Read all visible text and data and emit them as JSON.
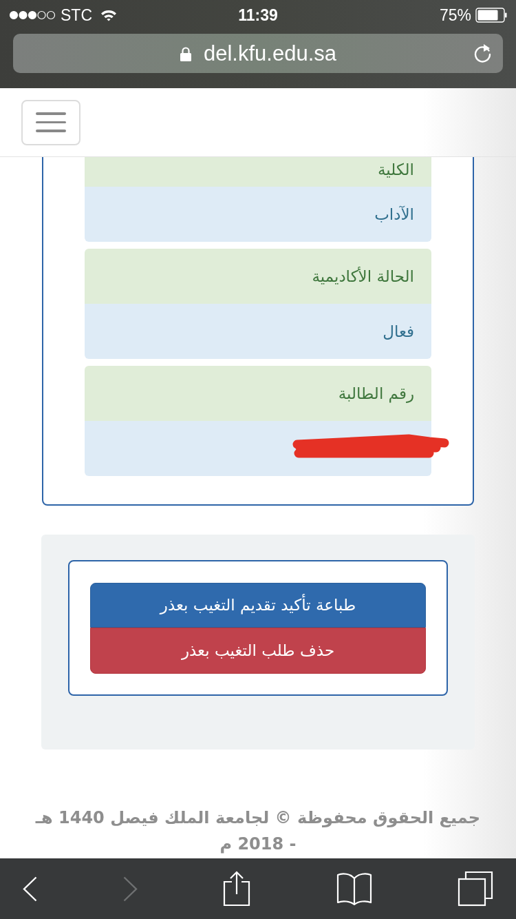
{
  "status_bar": {
    "carrier": "STC",
    "time": "11:39",
    "battery": "75%"
  },
  "address_bar": {
    "url": "del.kfu.edu.sa"
  },
  "info_card": {
    "fields": [
      {
        "label": "الكلية",
        "value": "الآداب",
        "redacted": false
      },
      {
        "label": "الحالة الأكاديمية",
        "value": "فعال",
        "redacted": false
      },
      {
        "label": "رقم الطالبة",
        "redacted": true
      }
    ]
  },
  "actions": {
    "buttons": [
      {
        "label": "طباعة تأكيد تقديم التغيب بعذر",
        "kind": "primary"
      },
      {
        "label": "حذف طلب التغيب بعذر",
        "kind": "danger"
      }
    ]
  },
  "footer": {
    "text": "جميع الحقوق محفوظة © لجامعة الملك فيصل 1440 هـ - 2018 م"
  },
  "toolbar": {
    "buttons": [
      {
        "kind": "back",
        "disabled": false
      },
      {
        "kind": "forward",
        "disabled": true
      },
      {
        "kind": "share",
        "disabled": false
      },
      {
        "kind": "bookmarks",
        "disabled": false
      },
      {
        "kind": "tabs",
        "disabled": false
      }
    ]
  }
}
